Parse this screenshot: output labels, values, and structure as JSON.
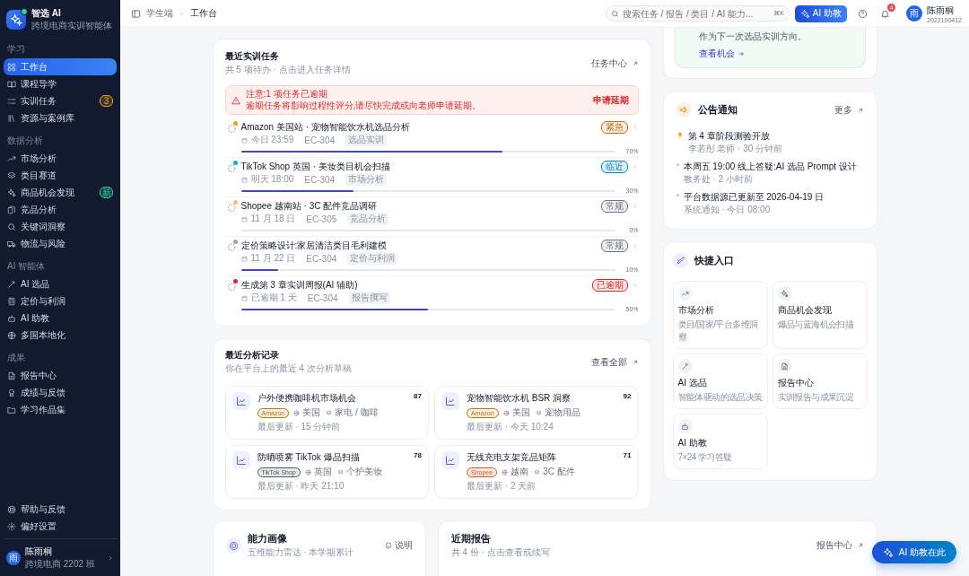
{
  "sidebar": {
    "brand": {
      "name": "智选 AI",
      "subtitle": "跨境电商实训智能体",
      "online": true
    },
    "sections": [
      {
        "title": "学习",
        "items": [
          {
            "label": "工作台",
            "selected": true
          },
          {
            "label": "课程导学",
            "selected": false
          },
          {
            "label": "实训任务",
            "selected": false,
            "badge": {
              "text": "3",
              "color": "#f5a524"
            }
          },
          {
            "label": "资源与案例库",
            "selected": false
          }
        ]
      },
      {
        "title": "数据分析",
        "items": [
          {
            "label": "市场分析",
            "selected": false
          },
          {
            "label": "类目赛道",
            "selected": false
          },
          {
            "label": "商品机会发现",
            "selected": false,
            "badge": {
              "text": "新",
              "color": "#34d399"
            }
          },
          {
            "label": "竞品分析",
            "selected": false
          },
          {
            "label": "关键词洞察",
            "selected": false
          },
          {
            "label": "物流与风险",
            "selected": false
          }
        ]
      },
      {
        "title": "AI 智能体",
        "items": [
          {
            "label": "AI 选品",
            "selected": false
          },
          {
            "label": "定价与利润",
            "selected": false
          },
          {
            "label": "AI 助教",
            "selected": false
          },
          {
            "label": "多国本地化",
            "selected": false
          }
        ]
      },
      {
        "title": "成果",
        "items": [
          {
            "label": "报告中心",
            "selected": false
          },
          {
            "label": "成绩与反馈",
            "selected": false
          },
          {
            "label": "学习作品集",
            "selected": false
          }
        ]
      }
    ],
    "footer_items": [
      {
        "label": "帮助与反馈"
      },
      {
        "label": "偏好设置"
      }
    ],
    "user": {
      "avatar": "雨",
      "name": "陈雨桐",
      "class": "跨境电商 2202 班"
    }
  },
  "header": {
    "breadcrumb": [
      "学生端",
      "工作台"
    ],
    "search": {
      "placeholder": "搜索任务 / 报告 / 类目 / AI 能力...",
      "shortcut": "⌘K"
    },
    "ai_button": "AI 助教",
    "notifications": "4",
    "user": {
      "avatar": "雨",
      "name": "陈雨桐",
      "id": "2022100412"
    }
  },
  "tasks_card": {
    "title": "最近实训任务",
    "subtitle": "共 5 项待办 · 点击进入任务详情",
    "link": "任务中心",
    "alert": {
      "title": "注意:1 项任务已逾期",
      "message": "逾期任务将影响过程性评分,请尽快完成或向老师申请延期。",
      "action": "申请延期"
    },
    "tasks": [
      {
        "title": "Amazon 美国站 · 宠物智能饮水机选品分析",
        "color": "#f59e0b",
        "due": "今日 23:59",
        "code": "EC-304",
        "tag": "选品实训",
        "priority": {
          "text": "紧急",
          "color": "#c2700a"
        },
        "level": 0.7,
        "percent": "70%"
      },
      {
        "title": "TikTok Shop 英国 · 美妆类目机会扫描",
        "color": "#0ea5e9",
        "due": "明天 18:00",
        "code": "EC-304",
        "tag": "市场分析",
        "priority": {
          "text": "临近",
          "color": "#0284c7"
        },
        "level": 0.3,
        "percent": "30%"
      },
      {
        "title": "Shopee 越南站 · 3C 配件竞品调研",
        "color": "#fbbf77",
        "due": "11 月 18 日",
        "code": "EC-305",
        "tag": "竞品分析",
        "priority": {
          "text": "常规",
          "color": "#6b7280"
        },
        "level": 0,
        "percent": "0%"
      },
      {
        "title": "定价策略设计:家居清洁类目毛利建模",
        "color": "#9ca3af",
        "due": "11 月 22 日",
        "code": "EC-304",
        "tag": "定价与利润",
        "priority": {
          "text": "常规",
          "color": "#6b7280"
        },
        "level": 0.1,
        "percent": "10%"
      },
      {
        "title": "生成第 3 章实训周报(AI 辅助)",
        "color": "#dc2626",
        "due": "已逾期 1 天",
        "code": "EC-304",
        "tag": "报告撰写",
        "priority": {
          "text": "已逾期",
          "color": "#dc2626"
        },
        "level": 0.5,
        "percent": "50%"
      }
    ]
  },
  "analysis_card": {
    "title": "最近分析记录",
    "subtitle": "你在平台上的最近 4 次分析草稿",
    "link": "查看全部",
    "records": [
      {
        "title": "户外便携咖啡机市场机会",
        "score": "87",
        "platform": {
          "text": "Amazon",
          "color": "#c2700a"
        },
        "country": "美国",
        "category": "家电 / 咖啡",
        "updated": "最后更新 · 15 分钟前"
      },
      {
        "title": "宠物智能饮水机 BSR 洞察",
        "score": "92",
        "platform": {
          "text": "Amazon",
          "color": "#c2700a"
        },
        "country": "美国",
        "category": "宠物用品",
        "updated": "最后更新 · 今天 10:24"
      },
      {
        "title": "防晒喷雾 TikTok 爆品扫描",
        "score": "78",
        "platform": {
          "text": "TikTok Shop",
          "color": "#4b5563"
        },
        "country": "英国",
        "category": "个护美妆",
        "updated": "最后更新 · 昨天 21:10"
      },
      {
        "title": "无线充电支架竞品矩阵",
        "score": "71",
        "platform": {
          "text": "Shopee",
          "color": "#e0521b"
        },
        "country": "越南",
        "category": "3C 配件",
        "updated": "最后更新 · 2 天前"
      }
    ]
  },
  "opportunity_card": {
    "text": "作为下一次选品实训方向。",
    "link": "查看机会"
  },
  "announcements": {
    "title": "公告通知",
    "link": "更多",
    "items": [
      {
        "kind": "pinned",
        "title": "第 4 章阶段测验开放",
        "meta": "李若彤 老师 · 30 分钟前"
      },
      {
        "kind": "normal",
        "title": "本周五 19:00 线上答疑:AI 选品 Prompt 设计",
        "meta": "教务处 · 2 小时前"
      },
      {
        "kind": "normal",
        "title": "平台数据源已更新至 2026-04-19 日",
        "meta": "系统通知 · 今日 08:00"
      }
    ]
  },
  "quick_entry": {
    "title": "快捷入口",
    "items": [
      {
        "title": "市场分析",
        "desc": "类目/国家/平台多维洞察"
      },
      {
        "title": "商品机会发现",
        "desc": "爆品与蓝海机会扫描"
      },
      {
        "title": "AI 选品",
        "desc": "智能体驱动的选品决策"
      },
      {
        "title": "报告中心",
        "desc": "实训报告与成果沉淀"
      },
      {
        "title": "AI 助教",
        "desc": "7×24 学习答疑"
      }
    ]
  },
  "ability_card": {
    "title": "能力画像",
    "subtitle": "五维能力雷达 · 本学期累计",
    "link": "说明"
  },
  "reports_card": {
    "title": "近期报告",
    "subtitle": "共 4 份 · 点击查看或续写",
    "link": "报告中心"
  },
  "fab": "AI 助教在此"
}
